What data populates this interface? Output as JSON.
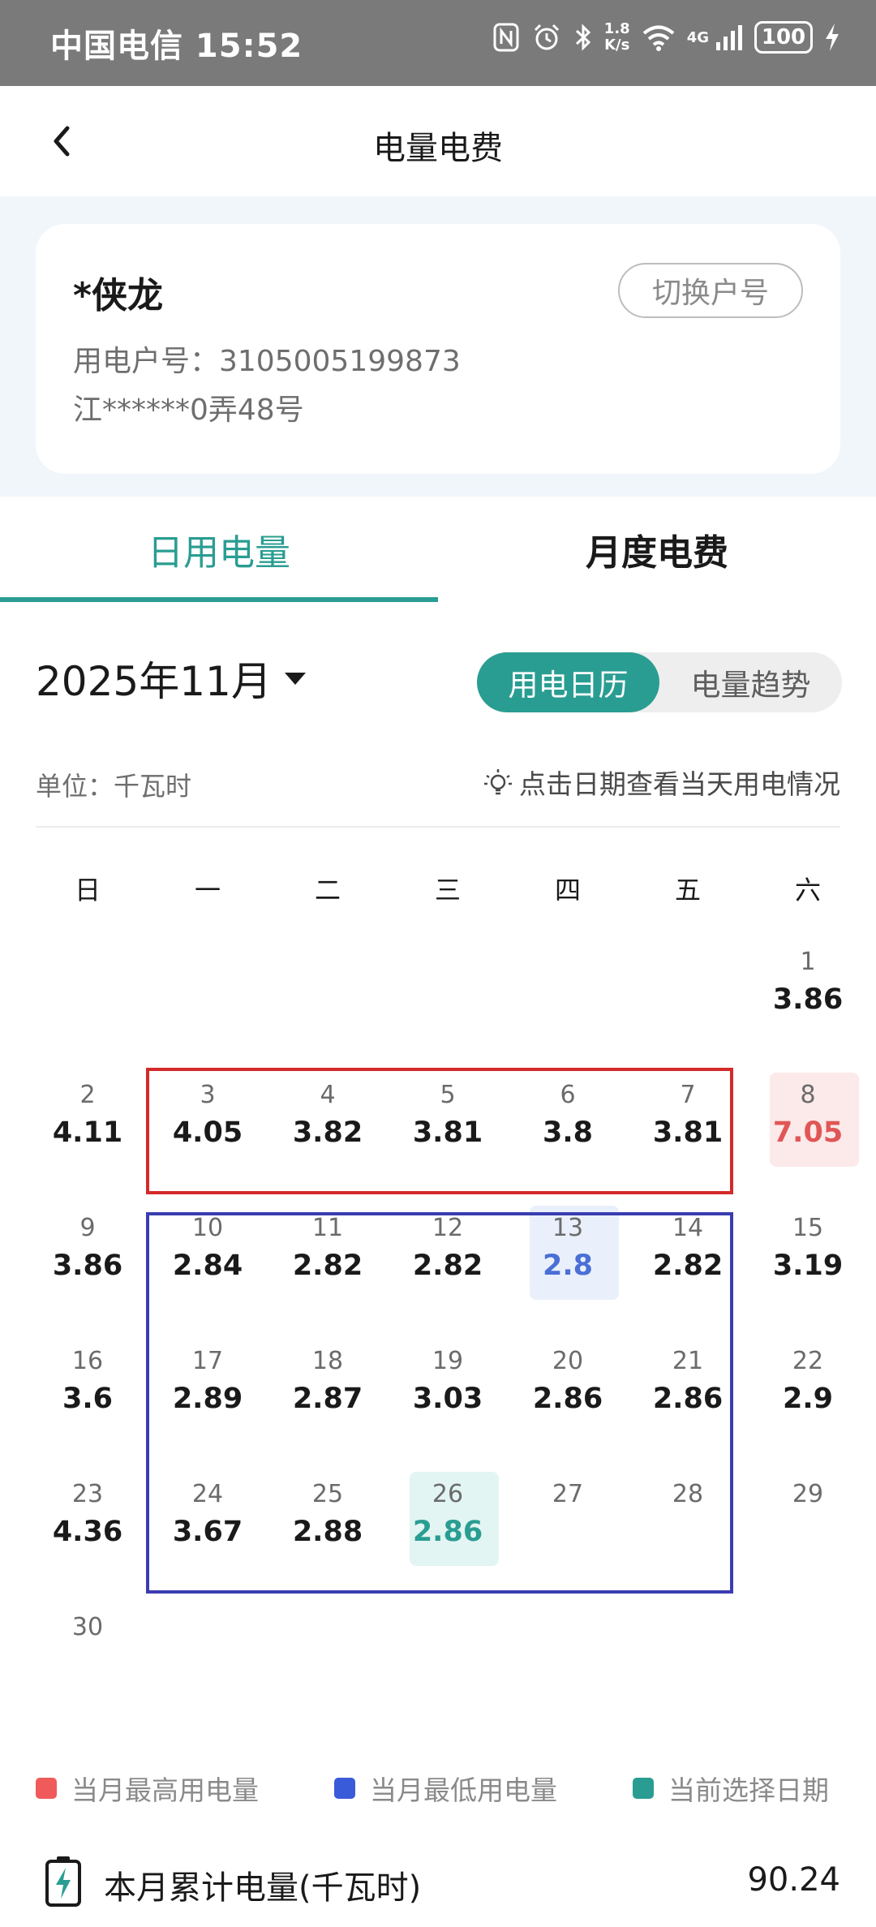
{
  "status_bar": {
    "carrier_time": "中国电信 15:52",
    "net_speed_value": "1.8",
    "net_speed_unit": "K/s",
    "network": "4G",
    "battery": "100",
    "icons": [
      "nfc-icon",
      "alarm-icon",
      "bluetooth-icon",
      "wifi-icon",
      "signal-icon",
      "battery-icon",
      "charging-icon"
    ]
  },
  "header": {
    "title": "电量电费",
    "back_icon": "chevron-left-icon"
  },
  "account": {
    "name": "*侠龙",
    "switch_label": "切换户号",
    "account_no": "用电户号：3105005199873",
    "address": "江******0弄48号"
  },
  "tabs": [
    {
      "label": "日用电量",
      "active": true
    },
    {
      "label": "月度电费",
      "active": false
    }
  ],
  "month": {
    "label": "2025年11月"
  },
  "view_toggle": {
    "options": [
      "用电日历",
      "电量趋势"
    ],
    "selected": "用电日历"
  },
  "unit_label": "单位：千瓦时",
  "hint": "点击日期查看当天用电情况",
  "weekdays": [
    "日",
    "一",
    "二",
    "三",
    "四",
    "五",
    "六"
  ],
  "calendar": {
    "days": [
      {
        "day": "1",
        "value": "3.86",
        "weekday": 6,
        "week": 0
      },
      {
        "day": "2",
        "value": "4.11",
        "weekday": 0,
        "week": 1
      },
      {
        "day": "3",
        "value": "4.05",
        "weekday": 1,
        "week": 1
      },
      {
        "day": "4",
        "value": "3.82",
        "weekday": 2,
        "week": 1
      },
      {
        "day": "5",
        "value": "3.81",
        "weekday": 3,
        "week": 1
      },
      {
        "day": "6",
        "value": "3.8",
        "weekday": 4,
        "week": 1
      },
      {
        "day": "7",
        "value": "3.81",
        "weekday": 5,
        "week": 1
      },
      {
        "day": "8",
        "value": "7.05",
        "weekday": 6,
        "week": 1,
        "highlight": "max"
      },
      {
        "day": "9",
        "value": "3.86",
        "weekday": 0,
        "week": 2
      },
      {
        "day": "10",
        "value": "2.84",
        "weekday": 1,
        "week": 2
      },
      {
        "day": "11",
        "value": "2.82",
        "weekday": 2,
        "week": 2
      },
      {
        "day": "12",
        "value": "2.82",
        "weekday": 3,
        "week": 2
      },
      {
        "day": "13",
        "value": "2.8",
        "weekday": 4,
        "week": 2,
        "highlight": "min"
      },
      {
        "day": "14",
        "value": "2.82",
        "weekday": 5,
        "week": 2
      },
      {
        "day": "15",
        "value": "3.19",
        "weekday": 6,
        "week": 2
      },
      {
        "day": "16",
        "value": "3.6",
        "weekday": 0,
        "week": 3
      },
      {
        "day": "17",
        "value": "2.89",
        "weekday": 1,
        "week": 3
      },
      {
        "day": "18",
        "value": "2.87",
        "weekday": 2,
        "week": 3
      },
      {
        "day": "19",
        "value": "3.03",
        "weekday": 3,
        "week": 3
      },
      {
        "day": "20",
        "value": "2.86",
        "weekday": 4,
        "week": 3
      },
      {
        "day": "21",
        "value": "2.86",
        "weekday": 5,
        "week": 3
      },
      {
        "day": "22",
        "value": "2.9",
        "weekday": 6,
        "week": 3
      },
      {
        "day": "23",
        "value": "4.36",
        "weekday": 0,
        "week": 4
      },
      {
        "day": "24",
        "value": "3.67",
        "weekday": 1,
        "week": 4
      },
      {
        "day": "25",
        "value": "2.88",
        "weekday": 2,
        "week": 4
      },
      {
        "day": "26",
        "value": "2.86",
        "weekday": 3,
        "week": 4,
        "highlight": "selected"
      },
      {
        "day": "27",
        "value": "",
        "weekday": 4,
        "week": 4
      },
      {
        "day": "28",
        "value": "",
        "weekday": 5,
        "week": 4
      },
      {
        "day": "29",
        "value": "",
        "weekday": 6,
        "week": 4
      },
      {
        "day": "30",
        "value": "",
        "weekday": 0,
        "week": 5
      }
    ]
  },
  "legend": [
    {
      "label": "当月最高用电量",
      "color": "#f05a5a"
    },
    {
      "label": "当月最低用电量",
      "color": "#3a5bd9"
    },
    {
      "label": "当前选择日期",
      "color": "#2a9d92"
    }
  ],
  "total": {
    "label": "本月累计电量(千瓦时)",
    "value": "90.24"
  },
  "colors": {
    "accent": "#2a9d92",
    "max": "#e05656",
    "min": "#4a6fd6",
    "annotation_red": "#d42a2a",
    "annotation_blue": "#3a3db0"
  }
}
